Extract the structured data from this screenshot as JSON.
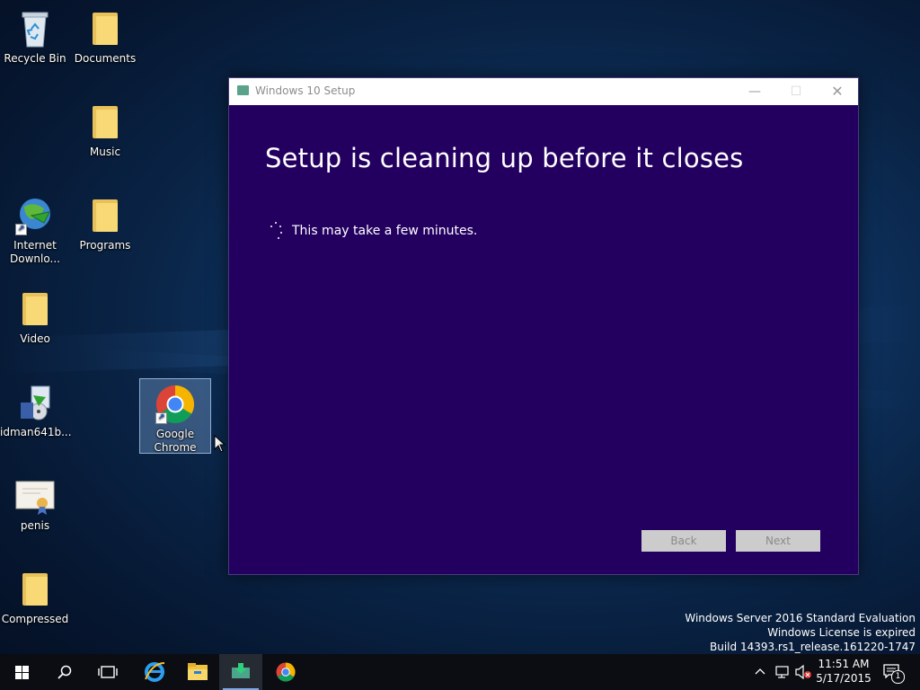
{
  "desktop": {
    "icons": [
      {
        "label": "Recycle Bin"
      },
      {
        "label": "Documents"
      },
      {
        "label": "Music"
      },
      {
        "label": "Internet Downlo..."
      },
      {
        "label": "Programs"
      },
      {
        "label": "Video"
      },
      {
        "label": "idman641b..."
      },
      {
        "label": "Google Chrome"
      },
      {
        "label": "penis"
      },
      {
        "label": "Compressed"
      }
    ]
  },
  "window": {
    "title": "Windows 10 Setup",
    "heading": "Setup is cleaning up before it closes",
    "message": "This may take a few minutes.",
    "back_label": "Back",
    "next_label": "Next",
    "bg_color": "#230060"
  },
  "watermark": {
    "line1": "Windows Server 2016 Standard Evaluation",
    "line2": "Windows License is expired",
    "line3": "Build 14393.rs1_release.161220-1747"
  },
  "taskbar": {
    "time": "11:51 AM",
    "date": "5/17/2015",
    "notification_count": "1",
    "pinned": [
      "start-icon",
      "search-icon",
      "task-view-icon",
      "internet-explorer-icon",
      "file-explorer-icon",
      "windows-setup-icon",
      "chrome-icon"
    ]
  }
}
